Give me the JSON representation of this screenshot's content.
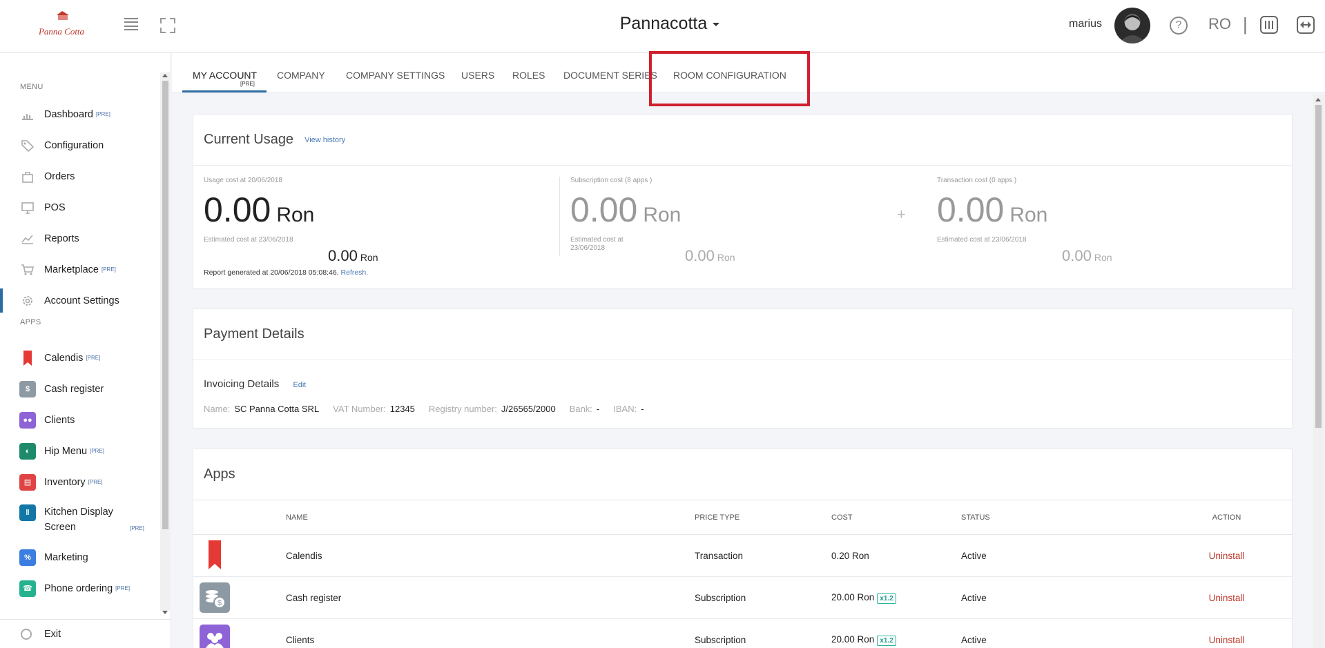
{
  "header": {
    "logo_text": "Panna Cotta",
    "company": "Pannacotta",
    "username": "marius",
    "help": "?",
    "language": "RO",
    "separator": "|"
  },
  "sidebar": {
    "menu_heading": "MENU",
    "apps_heading": "APPS",
    "menu_items": [
      {
        "label": "Dashboard",
        "badge": "[PRE]",
        "icon": "chart-icon"
      },
      {
        "label": "Configuration",
        "badge": "",
        "icon": "tag-icon"
      },
      {
        "label": "Orders",
        "badge": "",
        "icon": "bag-icon"
      },
      {
        "label": "POS",
        "badge": "",
        "icon": "monitor-icon"
      },
      {
        "label": "Reports",
        "badge": "",
        "icon": "line-chart-icon"
      },
      {
        "label": "Marketplace",
        "badge": "[PRE]",
        "icon": "cart-icon"
      },
      {
        "label": "Account Settings",
        "badge": "",
        "icon": "gear-icon"
      }
    ],
    "app_items": [
      {
        "label": "Calendis",
        "badge": "[PRE]",
        "color": "#e53935"
      },
      {
        "label": "Cash register",
        "badge": "",
        "color": "#8e9aa3"
      },
      {
        "label": "Clients",
        "badge": "",
        "color": "#8e63d6"
      },
      {
        "label": "Hip Menu",
        "badge": "[PRE]",
        "color": "#1f8a6b"
      },
      {
        "label": "Inventory",
        "badge": "[PRE]",
        "color": "#e04343"
      },
      {
        "label": "Kitchen Display Screen",
        "badge": "[PRE]",
        "color": "#1377a6"
      },
      {
        "label": "Marketing",
        "badge": "",
        "color": "#3b7de0"
      },
      {
        "label": "Phone ordering",
        "badge": "[PRE]",
        "color": "#25b38f"
      }
    ],
    "exit_label": "Exit"
  },
  "tabs": {
    "items": [
      "MY ACCOUNT",
      "COMPANY",
      "COMPANY SETTINGS",
      "USERS",
      "ROLES",
      "DOCUMENT SERIES",
      "ROOM CONFIGURATION"
    ],
    "active_badge": "[PRE]"
  },
  "usage": {
    "title": "Current Usage",
    "history_link": "View history",
    "usage_label": "Usage cost at 20/06/2018",
    "usage_value": "0.00",
    "currency": "Ron",
    "usage_est_label": "Estimated cost at 23/06/2018",
    "usage_est_value": "0.00",
    "sub_label": "Subscription cost (8 apps )",
    "sub_value": "0.00",
    "sub_est_label_1": "Estimated cost at",
    "sub_est_label_2": "23/06/2018",
    "sub_est_value": "0.00",
    "plus": "+",
    "trans_label": "Transaction cost (0 apps )",
    "trans_value": "0.00",
    "trans_est_label": "Estimated cost at 23/06/2018",
    "trans_est_value": "0.00",
    "report_text": "Report generated at 20/06/2018 05:08:46.",
    "refresh": "Refresh."
  },
  "payment": {
    "title": "Payment Details",
    "invoicing_title": "Invoicing Details",
    "edit": "Edit",
    "fields": [
      {
        "k": "Name:",
        "v": "SC Panna Cotta SRL"
      },
      {
        "k": "VAT Number:",
        "v": "12345"
      },
      {
        "k": "Registry number:",
        "v": "J/26565/2000"
      },
      {
        "k": "Bank:",
        "v": "-"
      },
      {
        "k": "IBAN:",
        "v": "-"
      }
    ]
  },
  "apps": {
    "title": "Apps",
    "columns": [
      "NAME",
      "PRICE TYPE",
      "COST",
      "STATUS",
      "ACTION"
    ],
    "rows": [
      {
        "name": "Calendis",
        "price_type": "Transaction",
        "cost": "0.20 Ron",
        "multiplier": "",
        "status": "Active",
        "action": "Uninstall",
        "color": "#e53935"
      },
      {
        "name": "Cash register",
        "price_type": "Subscription",
        "cost": "20.00 Ron",
        "multiplier": "x1.2",
        "status": "Active",
        "action": "Uninstall",
        "color": "#8e9aa3"
      },
      {
        "name": "Clients",
        "price_type": "Subscription",
        "cost": "20.00 Ron",
        "multiplier": "x1.2",
        "status": "Active",
        "action": "Uninstall",
        "color": "#8e63d6"
      }
    ]
  }
}
